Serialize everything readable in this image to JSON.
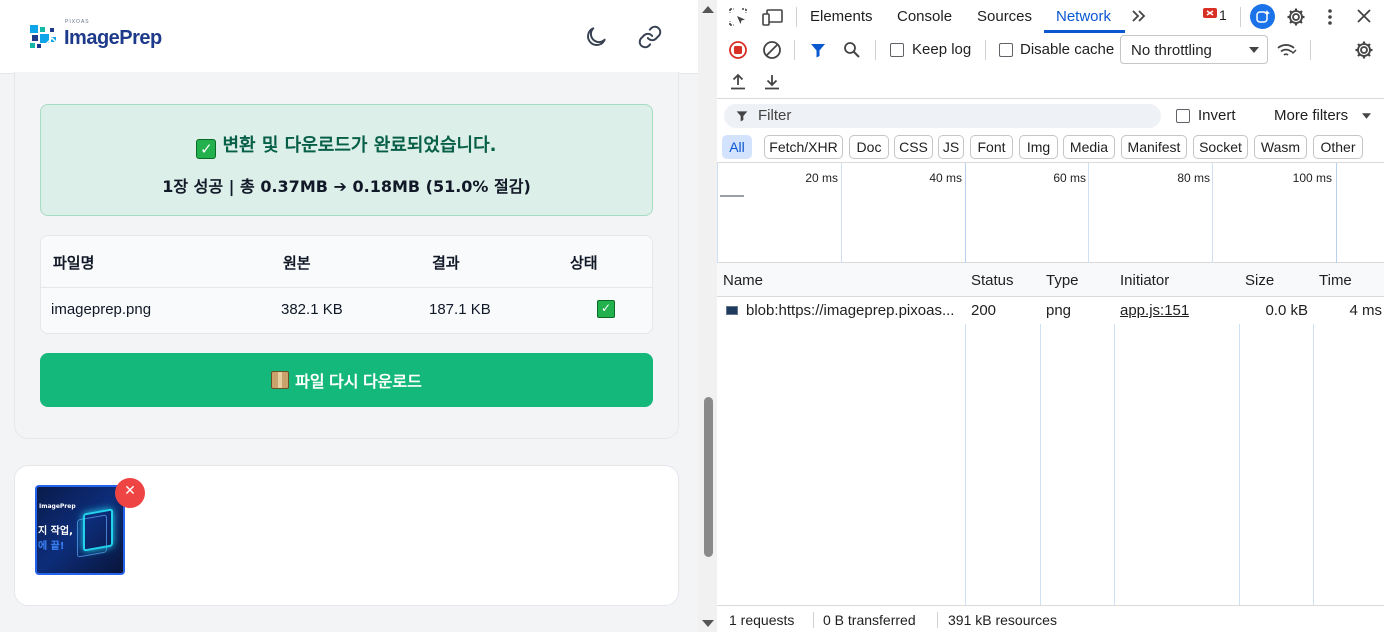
{
  "app": {
    "logo_sub": "PIXOAS",
    "logo_text": "ImagePrep"
  },
  "result": {
    "title": "변환 및 다운로드가 완료되었습니다.",
    "summary": "1장 성공 | 총 0.37MB ➔ 0.18MB (51.0% 절감)",
    "table_headers": [
      "파일명",
      "원본",
      "결과",
      "상태"
    ],
    "rows": [
      {
        "filename": "imageprep.png",
        "original": "382.1 KB",
        "result": "187.1 KB",
        "status": "done"
      }
    ],
    "download_again_label": "파일 다시 다운로드"
  },
  "ad": {
    "brand": "ImagePrep",
    "line2": "지 작업,",
    "line3": "에 끝!",
    "close": "✕"
  },
  "devtools": {
    "tabs": [
      "Elements",
      "Console",
      "Sources",
      "Network"
    ],
    "active_tab": "Network",
    "error_count": "1",
    "keep_log": "Keep log",
    "disable_cache": "Disable cache",
    "throttling": "No throttling",
    "filter_placeholder": "Filter",
    "invert": "Invert",
    "more_filters": "More filters",
    "chips": [
      "All",
      "Fetch/XHR",
      "Doc",
      "CSS",
      "JS",
      "Font",
      "Img",
      "Media",
      "Manifest",
      "Socket",
      "Wasm",
      "Other"
    ],
    "timeline_labels": [
      "20 ms",
      "40 ms",
      "60 ms",
      "80 ms",
      "100 ms"
    ],
    "columns": [
      "Name",
      "Status",
      "Type",
      "Initiator",
      "Size",
      "Time"
    ],
    "requests": [
      {
        "name": "blob:https://imageprep.pixoas...",
        "status": "200",
        "type": "png",
        "initiator": "app.js:151",
        "size": "0.0 kB",
        "time": "4 ms"
      }
    ],
    "status_bar": {
      "requests": "1 requests",
      "transferred": "0 B transferred",
      "resources": "391 kB resources"
    }
  },
  "colors": {
    "accent": "#14b87a",
    "success_bg": "#dcefe8",
    "devtools_blue": "#0b57d0",
    "record_red": "#d93025"
  }
}
